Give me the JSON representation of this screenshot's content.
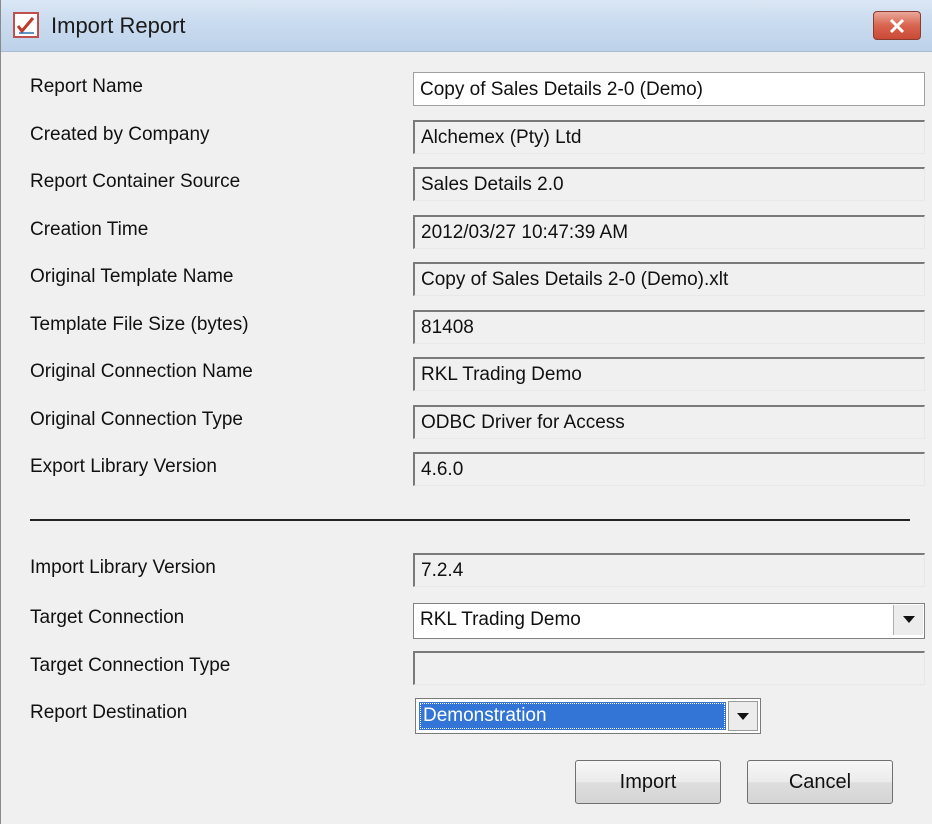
{
  "window": {
    "title": "Import Report"
  },
  "report_fields": [
    {
      "label": "Report Name",
      "value": "Copy of Sales Details 2-0 (Demo)"
    },
    {
      "label": "Created by Company",
      "value": "Alchemex (Pty) Ltd"
    },
    {
      "label": "Report Container Source",
      "value": "Sales Details 2.0"
    },
    {
      "label": "Creation Time",
      "value": "2012/03/27 10:47:39 AM"
    },
    {
      "label": "Original Template Name",
      "value": "Copy of Sales Details 2-0 (Demo).xlt"
    },
    {
      "label": "Template File Size (bytes)",
      "value": "81408"
    },
    {
      "label": "Original Connection Name",
      "value": "RKL Trading Demo"
    },
    {
      "label": "Original Connection Type",
      "value": "ODBC Driver for Access"
    },
    {
      "label": "Export Library Version",
      "value": "4.6.0"
    }
  ],
  "import_fields": {
    "import_library_version": {
      "label": "Import Library Version",
      "value": "7.2.4"
    },
    "target_connection": {
      "label": "Target Connection",
      "value": "RKL Trading Demo"
    },
    "target_connection_type": {
      "label": "Target Connection Type",
      "value": ""
    },
    "report_destination": {
      "label": "Report Destination",
      "value": "Demonstration"
    }
  },
  "buttons": {
    "import_label": "Import",
    "cancel_label": "Cancel"
  },
  "icons": {
    "app": "report-icon",
    "close": "close-icon",
    "dropdown": "chevron-down-icon"
  },
  "colors": {
    "titlebar": "#c9dbef",
    "close_button": "#d9644f",
    "selection": "#3375d6"
  }
}
